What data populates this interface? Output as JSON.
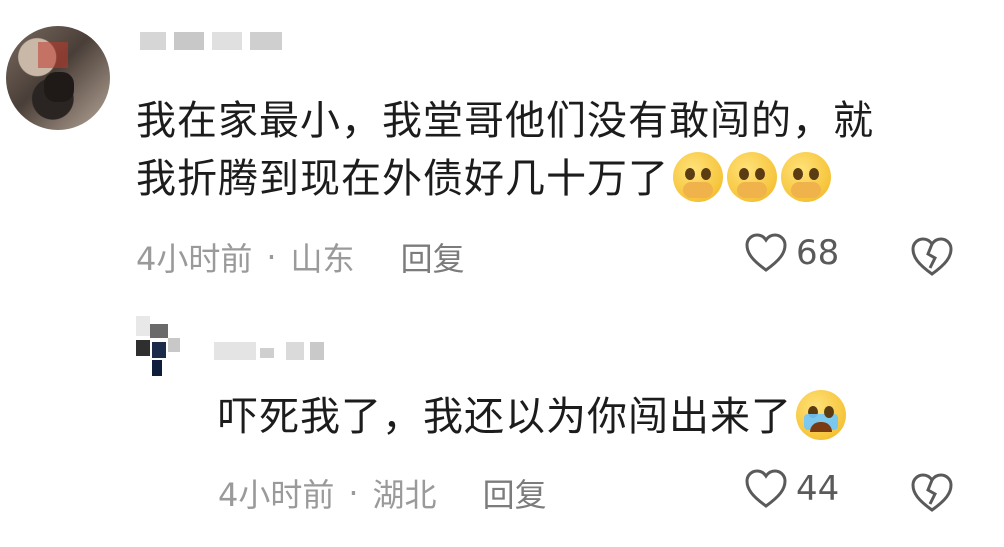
{
  "comments": [
    {
      "text_line1": "我在家最小，我堂哥他们没有敢闯的，就",
      "text_line2": "我折腾到现在外债好几十万了",
      "emoji": "pleading-face-icon",
      "time": "4小时前",
      "dot": "·",
      "location": "山东",
      "reply_label": "回复",
      "likes": "68"
    },
    {
      "text": "吓死我了，我还以为你闯出来了",
      "emoji": "crying-face-icon",
      "time": "4小时前",
      "dot": "·",
      "location": "湖北",
      "reply_label": "回复",
      "likes": "44"
    }
  ]
}
